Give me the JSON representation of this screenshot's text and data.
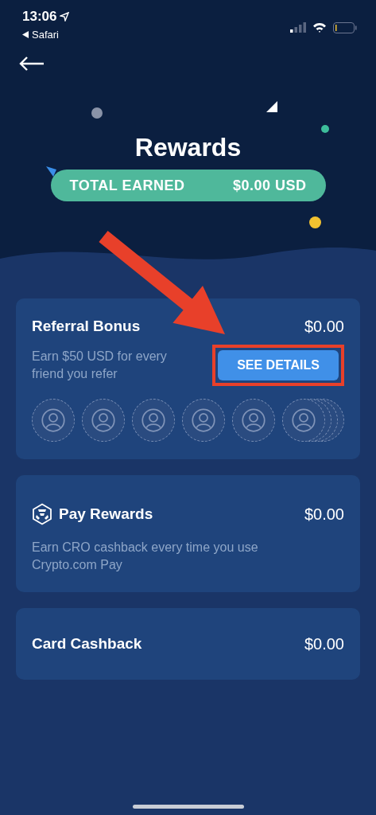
{
  "status_bar": {
    "time": "13:06",
    "back_app": "Safari"
  },
  "header": {
    "title": "Rewards",
    "total_label": "TOTAL EARNED",
    "total_value": "$0.00 USD"
  },
  "cards": [
    {
      "kind": "referral",
      "title": "Referral Bonus",
      "amount": "$0.00",
      "description": "Earn $50 USD for every friend you refer",
      "button": "SEE DETAILS",
      "highlighted": true,
      "friend_slots": [
        {
          "kind": "single"
        },
        {
          "kind": "single"
        },
        {
          "kind": "single"
        },
        {
          "kind": "single"
        },
        {
          "kind": "single"
        },
        {
          "kind": "stacked"
        }
      ]
    },
    {
      "kind": "pay",
      "title": "Pay Rewards",
      "amount": "$0.00",
      "description": "Earn CRO cashback every time you use Crypto.com Pay"
    },
    {
      "kind": "plain",
      "title": "Card Cashback",
      "amount": "$0.00"
    }
  ],
  "annotation": {
    "arrow": true
  }
}
